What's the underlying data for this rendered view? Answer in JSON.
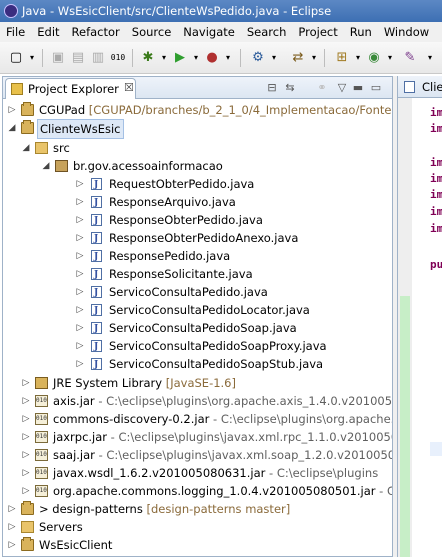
{
  "window": {
    "title": "Java - WsEsicClient/src/ClienteWsPedido.java - Eclipse"
  },
  "menu": [
    "File",
    "Edit",
    "Refactor",
    "Source",
    "Navigate",
    "Search",
    "Project",
    "Run",
    "Window",
    "H"
  ],
  "explorer": {
    "tab_label": "Project Explorer",
    "tab_close": "☒"
  },
  "tree": [
    {
      "name": "CGUPad",
      "decoration": "[CGUPAD/branches/b_2_1_0/4_Implementacao/Fontes/"
    },
    {
      "name": "ClienteWsEsic"
    },
    {
      "name": "src"
    },
    {
      "name": "br.gov.acessoainformacao"
    },
    {
      "name": "RequestObterPedido.java"
    },
    {
      "name": "ResponseArquivo.java"
    },
    {
      "name": "ResponseObterPedido.java"
    },
    {
      "name": "ResponseObterPedidoAnexo.java"
    },
    {
      "name": "ResponsePedido.java"
    },
    {
      "name": "ResponseSolicitante.java"
    },
    {
      "name": "ServicoConsultaPedido.java"
    },
    {
      "name": "ServicoConsultaPedidoLocator.java"
    },
    {
      "name": "ServicoConsultaPedidoSoap.java"
    },
    {
      "name": "ServicoConsultaPedidoSoapProxy.java"
    },
    {
      "name": "ServicoConsultaPedidoSoapStub.java"
    },
    {
      "name": "JRE System Library",
      "decoration": "[JavaSE-1.6]"
    },
    {
      "name": "axis.jar",
      "decoration": " - C:\\eclipse\\plugins\\org.apache.axis_1.4.0.v201005080"
    },
    {
      "name": "commons-discovery-0.2.jar",
      "decoration": " - C:\\eclipse\\plugins\\org.apache."
    },
    {
      "name": "jaxrpc.jar",
      "decoration": " - C:\\eclipse\\plugins\\javax.xml.rpc_1.1.0.v20100508"
    },
    {
      "name": "saaj.jar",
      "decoration": " - C:\\eclipse\\plugins\\javax.xml.soap_1.2.0.v20100505"
    },
    {
      "name": "javax.wsdl_1.6.2.v201005080631.jar",
      "decoration": " - C:\\eclipse\\plugins"
    },
    {
      "name": "org.apache.commons.logging_1.0.4.v201005080501.jar",
      "decoration": " - C:\\ec"
    },
    {
      "name": "> design-patterns",
      "decoration": "[design-patterns master]"
    },
    {
      "name": "Servers"
    },
    {
      "name": "WsEsicClient"
    }
  ],
  "editor": {
    "tab_label": "Clien",
    "code": [
      "im",
      "im",
      "im",
      "im",
      "im",
      "im",
      "im",
      "pu"
    ]
  }
}
